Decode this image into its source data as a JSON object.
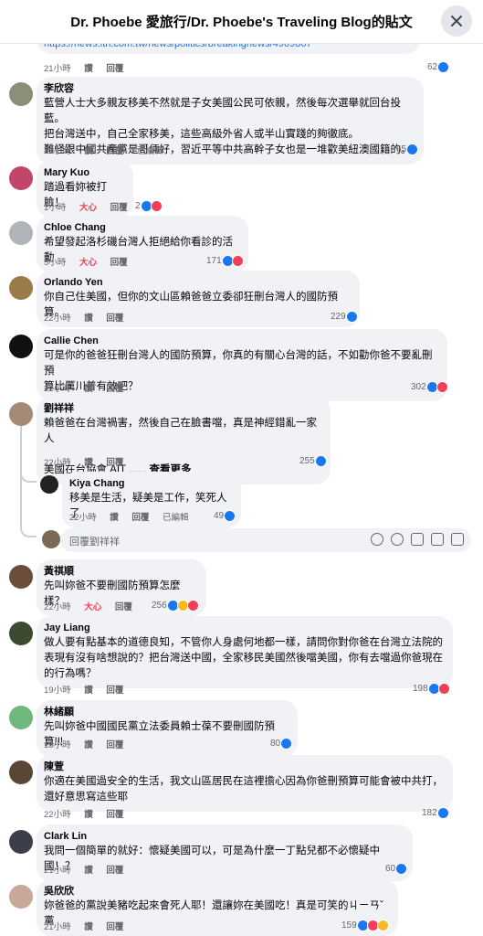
{
  "header": {
    "title": "Dr. Phoebe 愛旅行/Dr. Phoebe's Traveling Blog的貼文"
  },
  "top_link": {
    "url": "https://news.ltn.com.tw/news/politics/breakingnews/4969867",
    "time": "21小時",
    "like": "讚",
    "reply": "回覆",
    "count": "62"
  },
  "labels": {
    "like": "讚",
    "love": "大心",
    "reply": "回覆",
    "edited": "已編輯"
  },
  "comments": [
    {
      "author": "李欣容",
      "text": "藍營人士大多親友移美不然就是子女美國公民可依親，然後每次選舉就回台投藍。\n把台灣送中，自己全家移美，這些高級外省人或半山實踐的夠徹底。\n難怪跟中國共產黨是哥倆好，習近平等中共高幹子女也是一堆歡美紐澳國籍的。",
      "time": "20小時",
      "count": "65"
    },
    {
      "author": "Mary Kuo",
      "text": "踏過看妳被打臉！",
      "time": "1小時",
      "count": "2"
    },
    {
      "author": "Chloe Chang",
      "text": "希望發起洛杉磯台灣人拒絕給你看診的活動",
      "time": "5小時",
      "count": "171"
    },
    {
      "author": "Orlando Yen",
      "text": "你自己住美國，但你的文山區賴爸爸立委卻狂刪台灣人的國防預算。",
      "time": "22小時",
      "count": "229"
    },
    {
      "author": "Callie Chen",
      "text": "可是你的爸爸狂刪台灣人的國防預算，你真的有關心台灣的話，不如勸你爸不要亂刪預\n算比厲川普有效吧？",
      "time": "22小時",
      "count": "302"
    },
    {
      "author": "劉祥祥",
      "text": "賴爸爸在台灣禍害，然後自己在臉書噹，真是神經錯亂一家人\n\n美國在台協會 AIT ......",
      "see_more": "查看更多",
      "time": "22小時",
      "count": "255"
    },
    {
      "author": "Kiya Chang",
      "text": "移美是生活，疑美是工作，笑死人了",
      "time": "22小時",
      "count": "49"
    },
    {
      "author": "黃祺順",
      "text": "先叫妳爸不要刪國防預算怎麼樣？",
      "time": "22小時",
      "count": "256"
    },
    {
      "author": "Jay Liang",
      "text": "做人要有點基本的道德良知，不管你人身處何地都一樣，請問你對你爸在台灣立法院的\n表現有沒有啥想說的？把台灣送中國，全家移民美國然後噹美國，你有去噹過你爸現在\n的行為嗎？",
      "time": "19小時",
      "count": "198"
    },
    {
      "author": "林緒願",
      "text": "先叫妳爸中國國民黨立法委員賴士葆不要刪國防預算!!!",
      "time": "18小時",
      "count": "80"
    },
    {
      "author": "陳萱",
      "text": "你適在美國過安全的生活，我文山區居民在這裡擔心因為你爸刪預算可能會被中共打，\n還好意思寫這些耶",
      "time": "22小時",
      "count": "182"
    },
    {
      "author": "Clark Lin",
      "text": "我問一個簡單的就好：懷疑美國可以，可是為什麼一丁點兒都不必懷疑中國！？",
      "time": "21小時",
      "count": "60"
    },
    {
      "author": "吳欣欣",
      "text": "妳爸爸的黨說美豬吃起來會死人耶！還讓妳在美國吃！真是可笑的ㄐㄧㄢˇ黨",
      "time": "21小時",
      "count": "159"
    }
  ],
  "reply_box": {
    "placeholder": "回覆劉祥祥"
  },
  "colors": {
    "link": "#216fdb",
    "like": "#1877f2",
    "love": "#f33e58",
    "haha": "#f7b928",
    "bubble": "#f0f2f5",
    "meta": "#65676b"
  }
}
